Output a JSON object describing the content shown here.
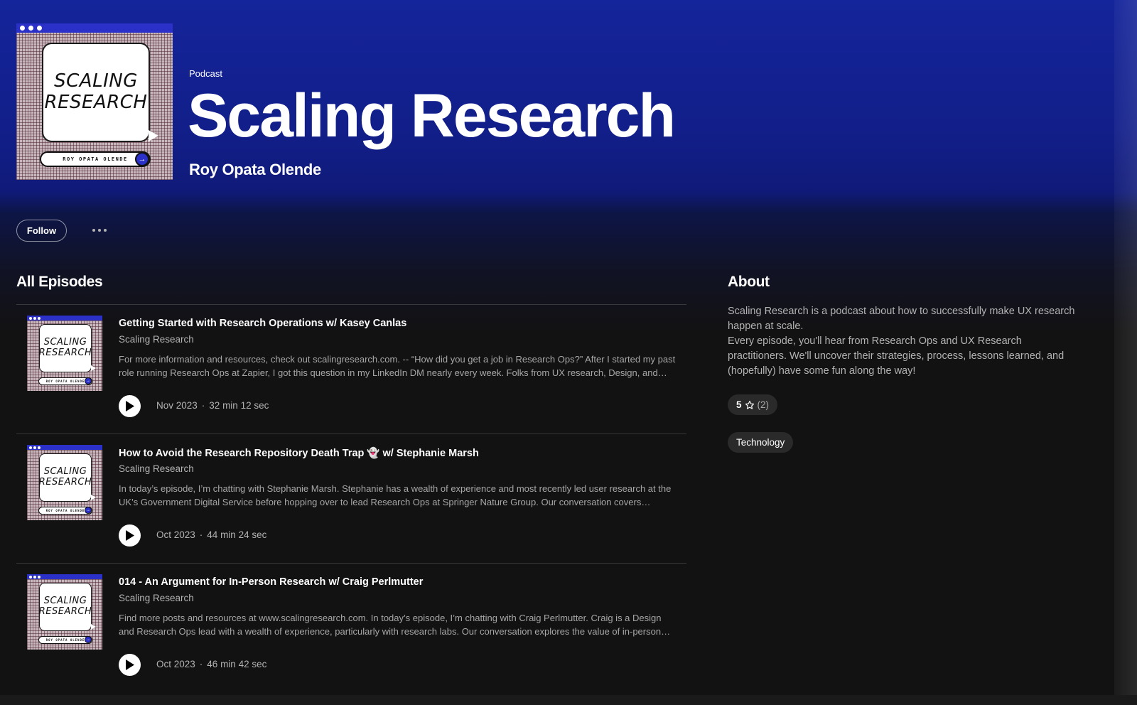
{
  "colors": {
    "header_blue": "#14249a",
    "background": "#121212",
    "text_primary": "#ffffff",
    "text_secondary": "#b3b3b3",
    "pill_background": "#2a2a2a"
  },
  "cover_art": {
    "line1": "SCALING",
    "line2": "RESEARCH",
    "author_pill": "ROY OPATA OLENDE",
    "icon": "arrow-right-icon"
  },
  "header": {
    "type_label": "Podcast",
    "title": "Scaling Research",
    "author": "Roy Opata Olende"
  },
  "actions": {
    "follow_label": "Follow",
    "more_icon": "more-horizontal-icon"
  },
  "episodes": {
    "section_title": "All Episodes",
    "items": [
      {
        "title": "Getting Started with Research Operations w/ Kasey Canlas",
        "show": "Scaling Research",
        "description": "For more information and resources, check out scalingresearch.com. -- “How did you get a job in Research Ops?” After I started my past role running Research Ops at Zapier, I got this question in my LinkedIn DM nearly every week. Folks from UX research, Design, and beyond wanted to know how to break in.",
        "date": "Nov 2023",
        "duration": "32 min 12 sec"
      },
      {
        "title": "How to Avoid the Research Repository Death Trap 👻 w/ Stephanie Marsh",
        "show": "Scaling Research",
        "description": "In today’s episode, I’m chatting with Stephanie Marsh. Stephanie has a wealth of experience and most recently led user research at the UK’s Government Digital Service before hopping over to lead Research Ops at Springer Nature Group. Our conversation covers research repositories and more.",
        "date": "Oct 2023",
        "duration": "44 min 24 sec"
      },
      {
        "title": "014 - An Argument for In-Person Research w/ Craig Perlmutter",
        "show": "Scaling Research",
        "description": "Find more posts and resources at www.scalingresearch.com. In today’s episode, I’m chatting with Craig Perlmutter. Craig is a Design and Research Ops lead with a wealth of experience, particularly with research labs. Our conversation explores the value of in-person research.",
        "date": "Oct 2023",
        "duration": "46 min 42 sec"
      }
    ]
  },
  "about": {
    "title": "About",
    "paragraph1": "Scaling Research is a podcast about how to successfully make UX research happen at scale.",
    "paragraph2": "Every episode, you'll hear from Research Ops and UX Research practitioners. We'll uncover their strategies, process, lessons learned, and (hopefully) have some fun along the way!",
    "rating_value": "5",
    "rating_icon": "star-outline-icon",
    "rating_count": "(2)",
    "category": "Technology"
  }
}
